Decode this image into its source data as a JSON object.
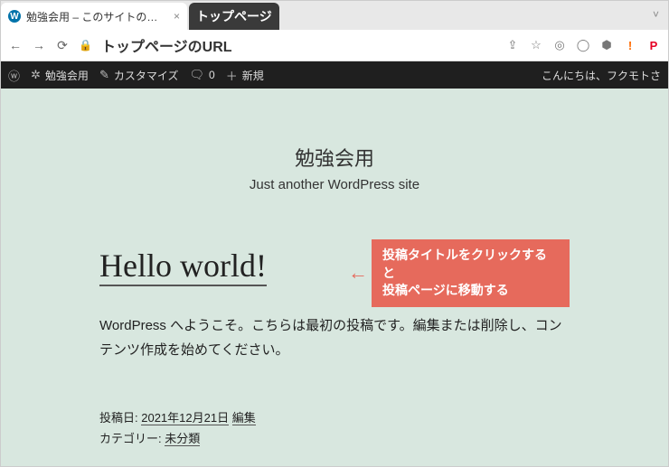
{
  "browser": {
    "active_tab_title": "勉強会用 – このサイトの簡単な説明",
    "dark_tab_title": "トップページ",
    "back_glyph": "←",
    "forward_glyph": "→",
    "reload_glyph": "⟳",
    "lock_glyph": "🔒",
    "url_display": "トップページのURL",
    "tab_caret": "˅",
    "ext": {
      "share": "⇪",
      "star": "☆",
      "cam": "◎",
      "gh": "◯",
      "brave": "⬢",
      "alert": "!",
      "pin": "P"
    }
  },
  "wp_bar": {
    "logo": "ⓦ",
    "site_name": "勉強会用",
    "customize_icon": "✎",
    "customize": "カスタマイズ",
    "comments_icon": "🗨",
    "comments_count": "0",
    "new_icon": "＋",
    "new_label": "新規",
    "greeting": "こんにちは、フクモトさ",
    "dash_icon": "✲"
  },
  "site": {
    "title": "勉強会用",
    "tagline": "Just another WordPress site"
  },
  "post": {
    "title": "Hello world!",
    "callout_arrow": "←",
    "callout_text": "投稿タイトルをクリックすると\n投稿ページに移動する",
    "excerpt": "WordPress へようこそ。こちらは最初の投稿です。編集または削除し、コンテンツ作成を始めてください。",
    "meta_date_label": "投稿日: ",
    "meta_date": "2021年12月21日",
    "meta_edit": "編集",
    "meta_cat_label": "カテゴリー: ",
    "meta_cat": "未分類"
  }
}
